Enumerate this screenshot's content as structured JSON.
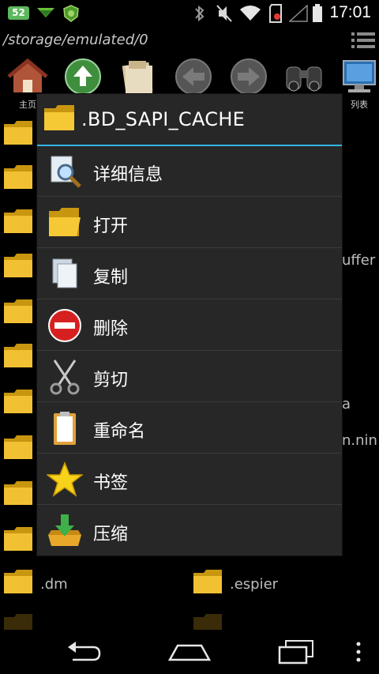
{
  "status_bar": {
    "notification_count": "52",
    "time": "17:01"
  },
  "path_bar": {
    "path": "/storage/emulated/0"
  },
  "toolbar": {
    "home_label": "主页",
    "list_label": "列表"
  },
  "background_files": {
    "partial_texts": [
      "uffer",
      "a",
      "n.nin"
    ],
    "bottom_row": [
      ".dm",
      ".espier"
    ]
  },
  "dialog": {
    "title": ".BD_SAPI_CACHE",
    "items": [
      {
        "label": "详细信息",
        "icon": "magnifier-document-icon"
      },
      {
        "label": "打开",
        "icon": "open-folder-icon"
      },
      {
        "label": "复制",
        "icon": "copy-icon"
      },
      {
        "label": "删除",
        "icon": "delete-icon"
      },
      {
        "label": "剪切",
        "icon": "scissors-icon"
      },
      {
        "label": "重命名",
        "icon": "rename-icon"
      },
      {
        "label": "书签",
        "icon": "star-icon"
      },
      {
        "label": "压缩",
        "icon": "compress-icon"
      }
    ],
    "accent_color": "#33b5e5"
  }
}
